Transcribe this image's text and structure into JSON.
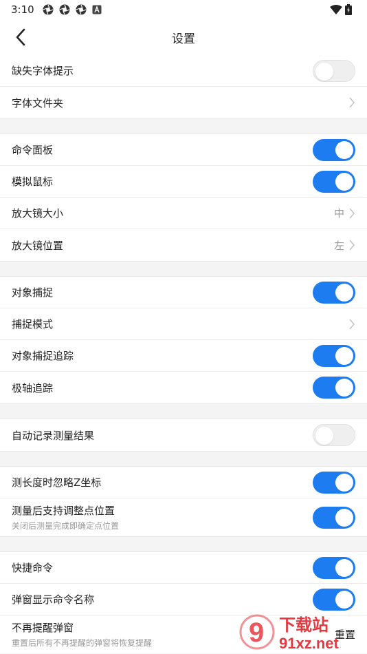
{
  "status": {
    "time": "3:10",
    "icons": [
      "aperture-icon",
      "aperture-icon",
      "aperture-icon",
      "a-badge-icon"
    ],
    "right_icons": [
      "wifi-icon",
      "battery-charging-icon"
    ]
  },
  "header": {
    "title": "设置",
    "back_icon": "back-chevron-icon"
  },
  "groups": [
    {
      "rows": [
        {
          "label": "缺失字体提示",
          "type": "toggle",
          "checked": false
        },
        {
          "label": "字体文件夹",
          "type": "chevron"
        }
      ]
    },
    {
      "rows": [
        {
          "label": "命令面板",
          "type": "toggle",
          "checked": true
        },
        {
          "label": "模拟鼠标",
          "type": "toggle",
          "checked": true
        },
        {
          "label": "放大镜大小",
          "type": "chevron",
          "value": "中"
        },
        {
          "label": "放大镜位置",
          "type": "chevron",
          "value": "左"
        }
      ]
    },
    {
      "rows": [
        {
          "label": "对象捕捉",
          "type": "toggle",
          "checked": true
        },
        {
          "label": "捕捉模式",
          "type": "chevron"
        },
        {
          "label": "对象捕捉追踪",
          "type": "toggle",
          "checked": true
        },
        {
          "label": "极轴追踪",
          "type": "toggle",
          "checked": true
        }
      ]
    },
    {
      "rows": [
        {
          "label": "自动记录测量结果",
          "type": "toggle",
          "checked": false
        }
      ]
    },
    {
      "rows": [
        {
          "label": "测长度时忽略Z坐标",
          "type": "toggle",
          "checked": true
        },
        {
          "label": "测量后支持调整点位置",
          "sub": "关闭后测量完成即确定点位置",
          "type": "toggle",
          "checked": true
        }
      ]
    },
    {
      "rows": [
        {
          "label": "快捷命令",
          "type": "toggle",
          "checked": true
        },
        {
          "label": "弹窗显示命令名称",
          "type": "toggle",
          "checked": true
        },
        {
          "label": "不再提醒弹窗",
          "sub": "重置后所有不再提醒的弹窗将恢复提醒",
          "type": "button",
          "button_label": "重置"
        }
      ]
    }
  ],
  "watermark": {
    "brand": "下载站",
    "site": "91xz.net",
    "glyph": "9"
  },
  "colors": {
    "accent": "#1d7cf0",
    "watermark": "#e6393f",
    "muted": "#9a9a9a"
  }
}
